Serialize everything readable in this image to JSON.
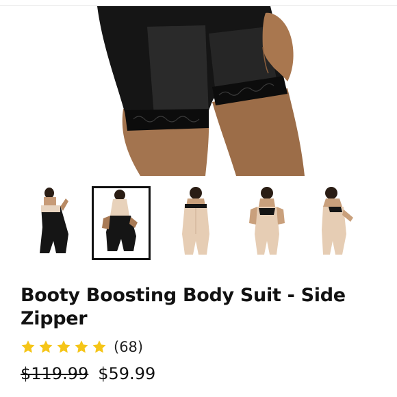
{
  "product": {
    "title": "Booty Boosting Body Suit - Side Zipper",
    "rating_count": "(68)",
    "rating_value": 5,
    "rating_max": 5,
    "price_original": "$119.99",
    "price_sale": "$59.99"
  },
  "gallery": {
    "thumbnails": [
      {
        "color": "black"
      },
      {
        "color": "black",
        "selected": true
      },
      {
        "color": "nude"
      },
      {
        "color": "nude"
      },
      {
        "color": "nude"
      }
    ]
  },
  "colors": {
    "star": "#f5c518",
    "selected_border": "#111111",
    "garment_black": "#151515",
    "garment_nude": "#e6cdb4",
    "skin": "#a3744f"
  }
}
